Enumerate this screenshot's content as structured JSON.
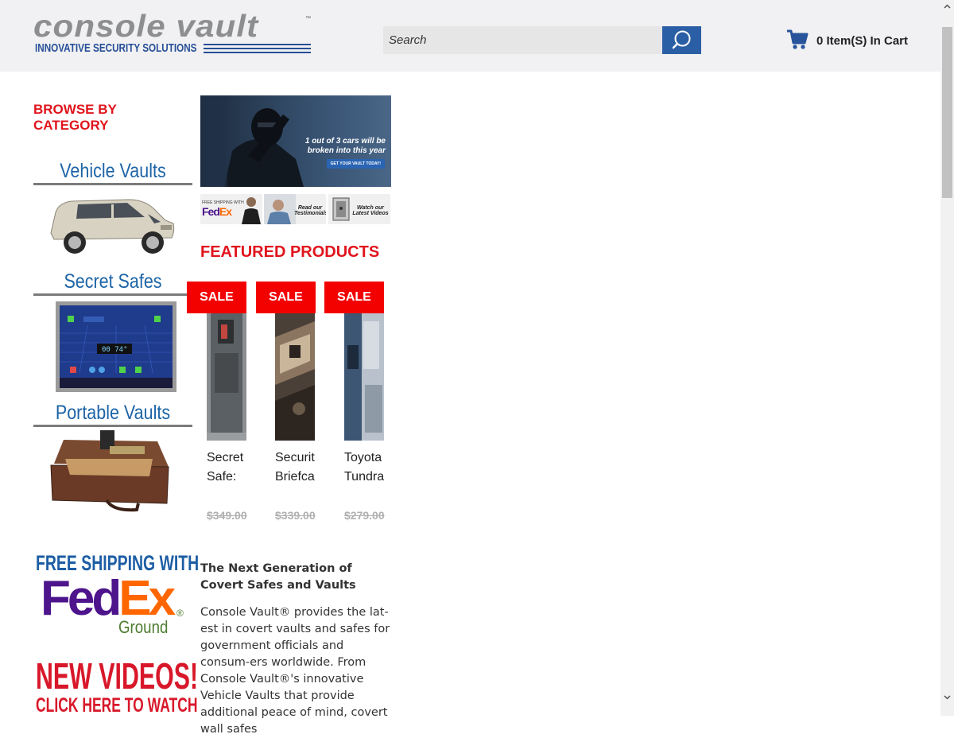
{
  "header": {
    "logo_main": "console vault",
    "logo_tm": "™",
    "logo_tagline": "INNOVATIVE SECURITY SOLUTIONS",
    "search_placeholder": "Search",
    "cart_text": "0 Item(S) In Cart",
    "icons": {
      "search": "search-icon",
      "cart": "cart-icon"
    },
    "accent_color": "#2b5fa5"
  },
  "sidebar": {
    "browse_title": "BROWSE BY CATEGORY",
    "categories": [
      {
        "title": "Vehicle Vaults"
      },
      {
        "title": "Secret Safes"
      },
      {
        "title": "Portable Vaults"
      }
    ],
    "shipping": {
      "line1": "FREE SHIPPING WITH",
      "brand_fed": "Fed",
      "brand_ex": "Ex",
      "reg": "®",
      "sub": "Ground"
    },
    "videos": {
      "line1": "NEW VIDEOS!",
      "line2": "CLICK HERE TO WATCH"
    }
  },
  "banner": {
    "text_line1": "1 out of 3 cars will be",
    "text_line2": "broken into this year",
    "button": "GET YOUR VAULT TODAY!"
  },
  "mini_banners": [
    {
      "label1": "Read our",
      "label2": "Testimonials"
    },
    {
      "label1": "Watch our",
      "label2": "Latest Videos"
    }
  ],
  "featured": {
    "title": "FEATURED PRODUCTS",
    "products": [
      {
        "badge": "SALE",
        "name_line1": "Secret",
        "name_line2": "Safe:",
        "price": "$349.00"
      },
      {
        "badge": "SALE",
        "name_line1": "Securit",
        "name_line2": "Briefca",
        "price": "$339.00"
      },
      {
        "badge": "SALE",
        "name_line1": "Toyota",
        "name_line2": "Tundra",
        "price": "$279.00"
      }
    ]
  },
  "article": {
    "heading": "The Next Generation of Covert Safes and Vaults",
    "body": "Console Vault® provides the lat-est in covert vaults and safes for government officials and consum-ers worldwide. From Console Vault®'s innovative Vehicle Vaults that provide additional peace of mind, covert wall safes"
  }
}
